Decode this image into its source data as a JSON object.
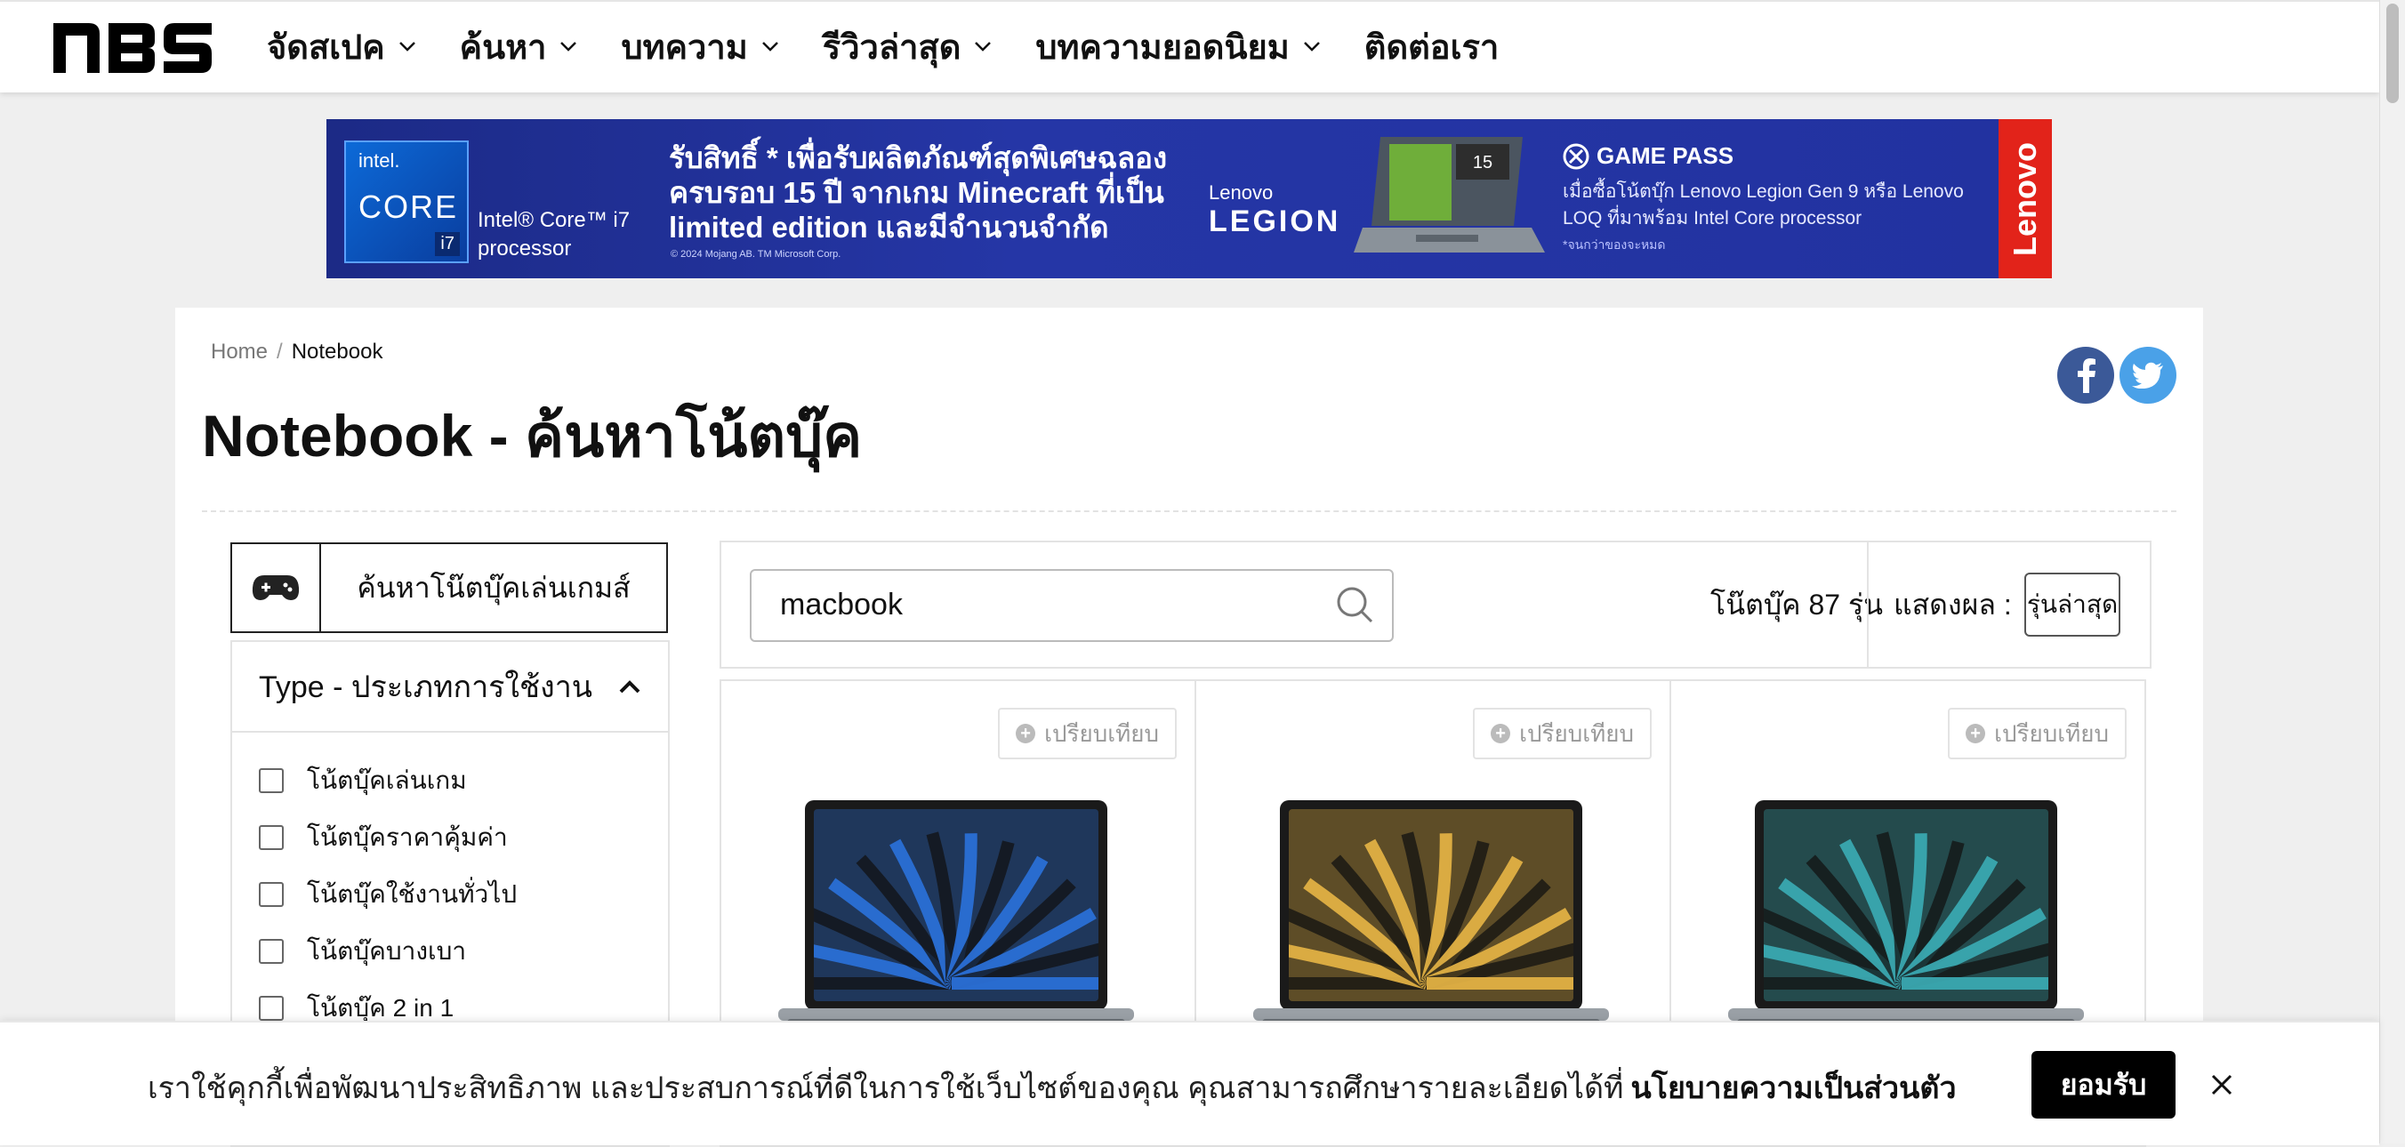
{
  "nav": {
    "logo_text": "NBS",
    "items": [
      {
        "label": "จัดสเปค",
        "has_dropdown": true
      },
      {
        "label": "ค้นหา",
        "has_dropdown": true
      },
      {
        "label": "บทความ",
        "has_dropdown": true
      },
      {
        "label": "รีวิวล่าสุด",
        "has_dropdown": true
      },
      {
        "label": "บทความยอดนิยม",
        "has_dropdown": true
      },
      {
        "label": "ติดต่อเรา",
        "has_dropdown": false
      }
    ]
  },
  "banner": {
    "intel_brand": "intel.",
    "intel_core": "CORE",
    "intel_tier": "i7",
    "intel_text": "Intel® Core™ i7 processor",
    "headline": "รับสิทธิ์ * เพื่อรับผลิตภัณฑ์สุดพิเศษฉลอง ครบรอบ 15 ปี จากเกม Minecraft ที่เป็น limited edition และมีจำนวนจำกัด",
    "fine_print": "© 2024 Mojang AB. TM Microsoft Corp.",
    "legion_top": "Lenovo",
    "legion_bottom": "LEGION",
    "gamepass_title": "GAME PASS",
    "gamepass_text": "เมื่อซื้อโน้ตบุ๊ก Lenovo Legion Gen 9 หรือ Lenovo LOQ ที่มาพร้อม Intel Core processor",
    "gamepass_note": "*จนกว่าของจะหมด",
    "lenovo": "Lenovo"
  },
  "breadcrumb": {
    "home": "Home",
    "separator": "/",
    "current": "Notebook"
  },
  "page_title": "Notebook - ค้นหาโน้ตบุ๊ค",
  "social": [
    "facebook-icon",
    "twitter-icon"
  ],
  "filters": {
    "gaming_button": "ค้นหาโน๊ตบุ๊คเล่นเกมส์",
    "type_header": "Type - ประเภทการใช้งาน",
    "options": [
      {
        "label": "โน้ตบุ๊คเล่นเกม",
        "checked": false
      },
      {
        "label": "โน้ตบุ๊คราคาคุ้มค่า",
        "checked": false
      },
      {
        "label": "โน้ตบุ๊คใช้งานทั่วไป",
        "checked": false
      },
      {
        "label": "โน้ตบุ๊คบางเบา",
        "checked": false
      },
      {
        "label": "โน้ตบุ๊ค 2 in 1",
        "checked": false
      }
    ]
  },
  "search": {
    "value": "macbook",
    "placeholder": ""
  },
  "results": {
    "count_label": "โน๊ตบุ๊ค 87 รุ่น",
    "show_label": "แสดงผล :",
    "sort_value": "รุ่นล่าสุด"
  },
  "products": [
    {
      "compare_label": "เปรียบเทียบ",
      "color_theme": "#2a6fd6"
    },
    {
      "compare_label": "เปรียบเทียบ",
      "color_theme": "#e0b043"
    },
    {
      "compare_label": "เปรียบเทียบ",
      "color_theme": "#3aa8b0"
    }
  ],
  "cookie": {
    "text": "เราใช้คุกกี้เพื่อพัฒนาประสิทธิภาพ และประสบการณ์ที่ดีในการใช้เว็บไซต์ของคุณ คุณสามารถศึกษารายละเอียดได้ที่",
    "link": "นโยบายความเป็นส่วนตัว",
    "accept": "ยอมรับ"
  }
}
